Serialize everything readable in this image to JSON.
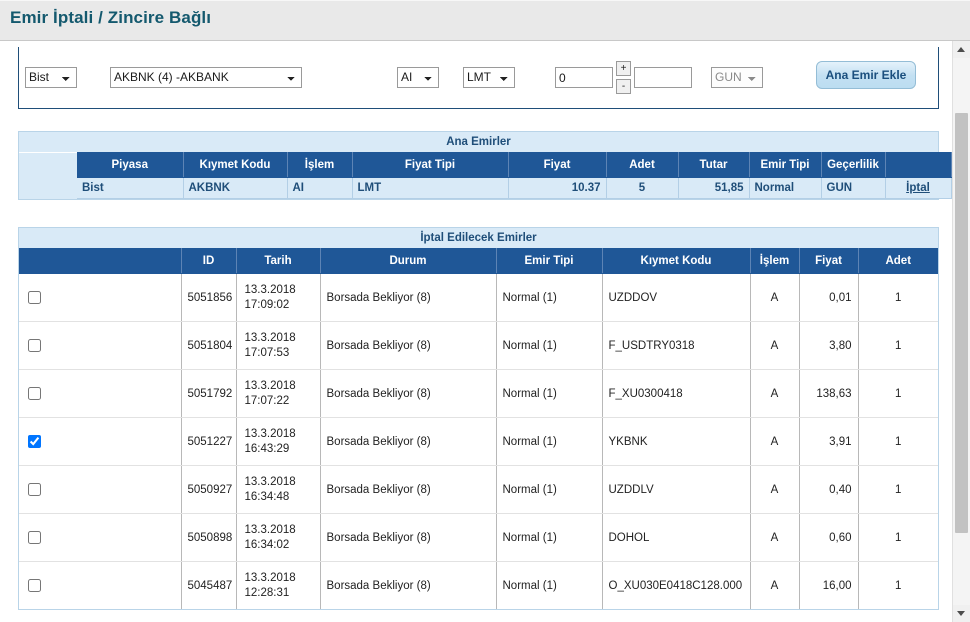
{
  "window": {
    "title": "Emir İptali / Zincire Bağlı"
  },
  "order_entry": {
    "market": "Bist",
    "symbol": "AKBNK (4) -AKBANK",
    "side": "AI",
    "price_type": "LMT",
    "price_value": "0",
    "quantity_value": "",
    "quantity_placeholder": "",
    "validity": "GUN",
    "spinner_up": "+",
    "spinner_down": "-",
    "add_button": "Ana Emir Ekle"
  },
  "main_orders": {
    "caption": "Ana Emirler",
    "columns": [
      "Piyasa",
      "Kıymet Kodu",
      "İşlem",
      "Fiyat Tipi",
      "Fiyat",
      "Adet",
      "Tutar",
      "Emir Tipi",
      "Geçerlilik",
      ""
    ],
    "rows": [
      {
        "piyasa": "Bist",
        "kiymet_kodu": "AKBNK",
        "islem": "AI",
        "fiyat_tipi": "LMT",
        "fiyat": "10.37",
        "adet": "5",
        "tutar": "51,85",
        "emir_tipi": "Normal",
        "gecerlilik": "GUN",
        "action": "İptal"
      }
    ]
  },
  "cancel_orders": {
    "caption": "İptal Edilecek Emirler",
    "columns": [
      "",
      "ID",
      "Tarih",
      "Durum",
      "Emir Tipi",
      "Kıymet Kodu",
      "İşlem",
      "Fiyat",
      "Adet"
    ],
    "rows": [
      {
        "checked": false,
        "id": "5051856",
        "date": "13.3.2018",
        "time": "17:09:02",
        "durum": "Borsada Bekliyor (8)",
        "emir_tipi": "Normal (1)",
        "kiymet_kodu": "UZDDOV",
        "islem": "A",
        "fiyat": "0,01",
        "adet": "1"
      },
      {
        "checked": false,
        "id": "5051804",
        "date": "13.3.2018",
        "time": "17:07:53",
        "durum": "Borsada Bekliyor (8)",
        "emir_tipi": "Normal (1)",
        "kiymet_kodu": "F_USDTRY0318",
        "islem": "A",
        "fiyat": "3,80",
        "adet": "1"
      },
      {
        "checked": false,
        "id": "5051792",
        "date": "13.3.2018",
        "time": "17:07:22",
        "durum": "Borsada Bekliyor (8)",
        "emir_tipi": "Normal (1)",
        "kiymet_kodu": "F_XU0300418",
        "islem": "A",
        "fiyat": "138,63",
        "adet": "1"
      },
      {
        "checked": true,
        "id": "5051227",
        "date": "13.3.2018",
        "time": "16:43:29",
        "durum": "Borsada Bekliyor (8)",
        "emir_tipi": "Normal (1)",
        "kiymet_kodu": "YKBNK",
        "islem": "A",
        "fiyat": "3,91",
        "adet": "1"
      },
      {
        "checked": false,
        "id": "5050927",
        "date": "13.3.2018",
        "time": "16:34:48",
        "durum": "Borsada Bekliyor (8)",
        "emir_tipi": "Normal (1)",
        "kiymet_kodu": "UZDDLV",
        "islem": "A",
        "fiyat": "0,40",
        "adet": "1"
      },
      {
        "checked": false,
        "id": "5050898",
        "date": "13.3.2018",
        "time": "16:34:02",
        "durum": "Borsada Bekliyor (8)",
        "emir_tipi": "Normal (1)",
        "kiymet_kodu": "DOHOL",
        "islem": "A",
        "fiyat": "0,60",
        "adet": "1"
      },
      {
        "checked": false,
        "id": "5045487",
        "date": "13.3.2018",
        "time": "12:28:31",
        "durum": "Borsada Bekliyor (8)",
        "emir_tipi": "Normal (1)",
        "kiymet_kodu": "O_XU030E0418C128.000",
        "islem": "A",
        "fiyat": "16,00",
        "adet": "1"
      }
    ]
  },
  "colors": {
    "title_text": "#14596e",
    "header_blue": "#1f5797",
    "panel_blue": "#d9eaf7",
    "accent_text": "#1f4e79"
  }
}
